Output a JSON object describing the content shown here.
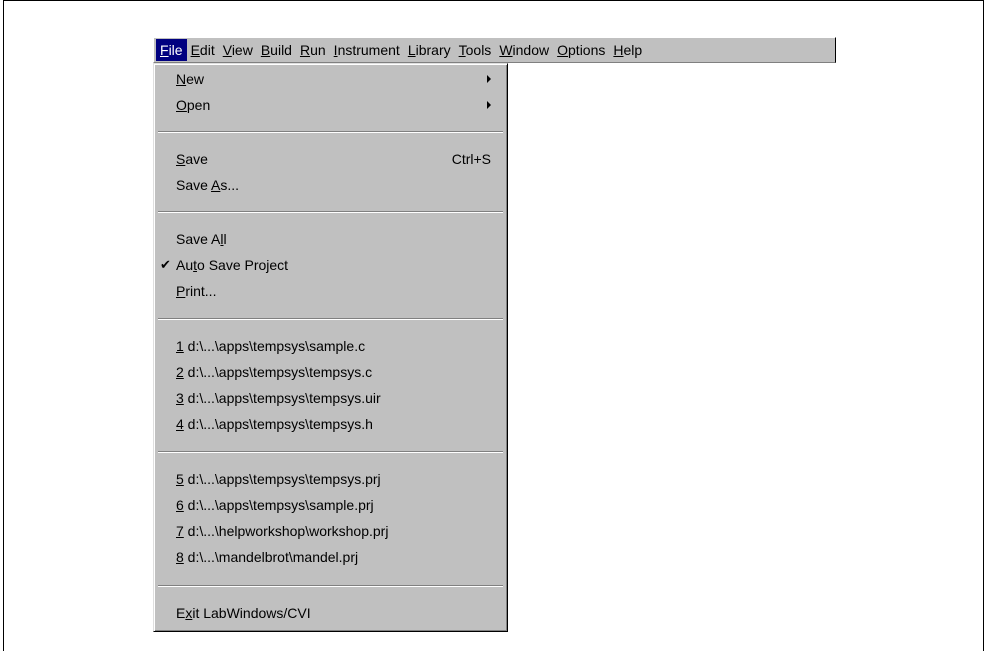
{
  "menubar": {
    "items": [
      {
        "pre": "",
        "key": "F",
        "post": "ile",
        "active": true
      },
      {
        "pre": "",
        "key": "E",
        "post": "dit"
      },
      {
        "pre": "",
        "key": "V",
        "post": "iew"
      },
      {
        "pre": "",
        "key": "B",
        "post": "uild"
      },
      {
        "pre": "",
        "key": "R",
        "post": "un"
      },
      {
        "pre": "",
        "key": "I",
        "post": "nstrument"
      },
      {
        "pre": "",
        "key": "L",
        "post": "ibrary"
      },
      {
        "pre": "",
        "key": "T",
        "post": "ools"
      },
      {
        "pre": "",
        "key": "W",
        "post": "indow"
      },
      {
        "pre": "",
        "key": "O",
        "post": "ptions"
      },
      {
        "pre": "",
        "key": "H",
        "post": "elp"
      }
    ]
  },
  "file_menu": {
    "new": {
      "pre": "",
      "key": "N",
      "post": "ew"
    },
    "open": {
      "pre": "",
      "key": "O",
      "post": "pen"
    },
    "save": {
      "pre": "",
      "key": "S",
      "post": "ave",
      "shortcut": "Ctrl+S"
    },
    "save_as": {
      "pre": "Save ",
      "key": "A",
      "post": "s..."
    },
    "save_all": {
      "pre": "Save A",
      "key": "l",
      "post": "l"
    },
    "auto_save": {
      "pre": "Au",
      "key": "t",
      "post": "o Save Project",
      "checked": true,
      "check_glyph": "✔"
    },
    "print": {
      "pre": "",
      "key": "P",
      "post": "rint..."
    },
    "recent_group1": [
      {
        "key": "1",
        "path": " d:\\...\\apps\\tempsys\\sample.c"
      },
      {
        "key": "2",
        "path": " d:\\...\\apps\\tempsys\\tempsys.c"
      },
      {
        "key": "3",
        "path": " d:\\...\\apps\\tempsys\\tempsys.uir"
      },
      {
        "key": "4",
        "path": " d:\\...\\apps\\tempsys\\tempsys.h"
      }
    ],
    "recent_group2": [
      {
        "key": "5",
        "path": " d:\\...\\apps\\tempsys\\tempsys.prj"
      },
      {
        "key": "6",
        "path": " d:\\...\\apps\\tempsys\\sample.prj"
      },
      {
        "key": "7",
        "path": " d:\\...\\helpworkshop\\workshop.prj"
      },
      {
        "key": "8",
        "path": " d:\\...\\mandelbrot\\mandel.prj"
      }
    ],
    "exit": {
      "pre": "E",
      "key": "x",
      "post": "it LabWindows/CVI"
    }
  },
  "colors": {
    "menu_face": "#c0c0c0",
    "highlight": "#000080",
    "highlight_text": "#ffffff"
  }
}
